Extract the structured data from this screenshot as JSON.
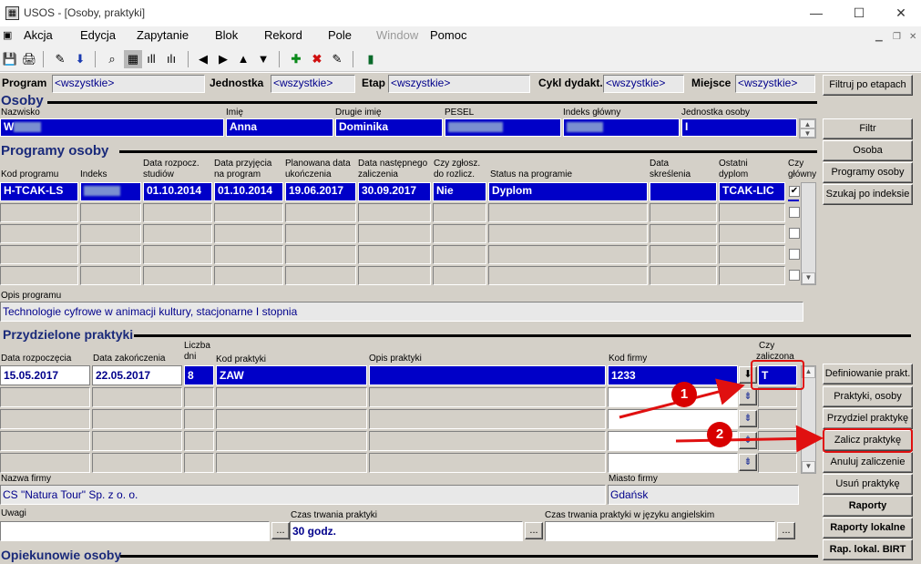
{
  "window": {
    "title": "USOS - [Osoby, praktyki]",
    "icon": "usos-app-icon"
  },
  "menu": [
    "Akcja",
    "Edycja",
    "Zapytanie",
    "Blok",
    "Rekord",
    "Pole",
    "Window",
    "Pomoc"
  ],
  "menu_disabled": [
    "Window"
  ],
  "filters": {
    "program_label": "Program",
    "program_value": "<wszystkie>",
    "jednostka_label": "Jednostka",
    "jednostka_value": "<wszystkie>",
    "etap_label": "Etap",
    "etap_value": "<wszystkie>",
    "cykl_label": "Cykl dydakt.",
    "cykl_value": "<wszystkie>",
    "miejsce_label": "Miejsce",
    "miejsce_value": "<wszystkie>",
    "filter_button": "Filtruj po etapach"
  },
  "osoby": {
    "section": "Osoby",
    "cols": {
      "nazwisko": "Nazwisko",
      "imie": "Imię",
      "drugie": "Drugie imię",
      "pesel": "PESEL",
      "indeks": "Indeks główny",
      "jednostka": "Jednostka osoby"
    },
    "row": {
      "nazwisko": "W",
      "imie": "Anna",
      "drugie": "Dominika",
      "pesel": "",
      "indeks": "",
      "jednostka": "I"
    }
  },
  "buttons_top": [
    "Filtr",
    "Osoba",
    "Programy osoby",
    "Szukaj po indeksie"
  ],
  "programy": {
    "section": "Programy osoby",
    "cols": {
      "kod": "Kod programu",
      "indeks": "Indeks",
      "data_rozp_1": "Data rozpocz.",
      "data_rozp_2": "studiów",
      "data_przyj_1": "Data przyjęcia",
      "data_przyj_2": "na program",
      "plan_1": "Planowana data",
      "plan_2": "ukończenia",
      "nast_1": "Data następnego",
      "nast_2": "zaliczenia",
      "zglosz_1": "Czy zgłosz.",
      "zglosz_2": "do rozlicz.",
      "status": "Status na programie",
      "skresl_1": "Data",
      "skresl_2": "skreślenia",
      "dyplom_1": "Ostatni",
      "dyplom_2": "dyplom",
      "glowny_1": "Czy",
      "glowny_2": "główny"
    },
    "row": {
      "kod": "H-TCAK-LS",
      "indeks": "",
      "data_rozp": "01.10.2014",
      "data_przyj": "01.10.2014",
      "plan": "19.06.2017",
      "nast": "30.09.2017",
      "zglosz": "Nie",
      "status": "Dyplom",
      "skresl": "",
      "dyplom": "TCAK-LIC",
      "glowny": "✔"
    }
  },
  "opis_programu": {
    "label": "Opis programu",
    "value": "Technologie cyfrowe w animacji kultury, stacjonarne I stopnia"
  },
  "praktyki": {
    "section": "Przydzielone praktyki",
    "cols": {
      "data_rozp": "Data rozpoczęcia",
      "data_zak": "Data zakończenia",
      "liczba_1": "Liczba",
      "liczba_2": "dni",
      "kod": "Kod praktyki",
      "opis": "Opis praktyki",
      "firma": "Kod firmy",
      "zal_1": "Czy",
      "zal_2": "zaliczona"
    },
    "row": {
      "data_rozp": "15.05.2017",
      "data_zak": "22.05.2017",
      "liczba": "8",
      "kod": "ZAW",
      "opis": "",
      "firma": "1233",
      "zal": "T"
    }
  },
  "buttons_right": [
    "Definiowanie prakt.",
    "Praktyki, osoby",
    "Przydziel praktykę",
    "Zalicz praktykę",
    "Anuluj zaliczenie",
    "Usuń praktykę",
    "Raporty",
    "Raporty lokalne",
    "Rap. lokal. BIRT"
  ],
  "firma": {
    "nazwa_label": "Nazwa firmy",
    "nazwa_value": "CS \"Natura Tour\" Sp. z o. o.",
    "miasto_label": "Miasto firmy",
    "miasto_value": "Gdańsk"
  },
  "uwagi": {
    "label": "Uwagi",
    "value": ""
  },
  "czas": {
    "label": "Czas trwania praktyki",
    "value": "30 godz."
  },
  "czas_en": {
    "label": "Czas trwania praktyki w języku angielskim",
    "value": ""
  },
  "opiekunowie": {
    "section": "Opiekunowie osoby"
  },
  "annotations": {
    "badge1": "1",
    "badge2": "2",
    "color": "#e01010"
  }
}
